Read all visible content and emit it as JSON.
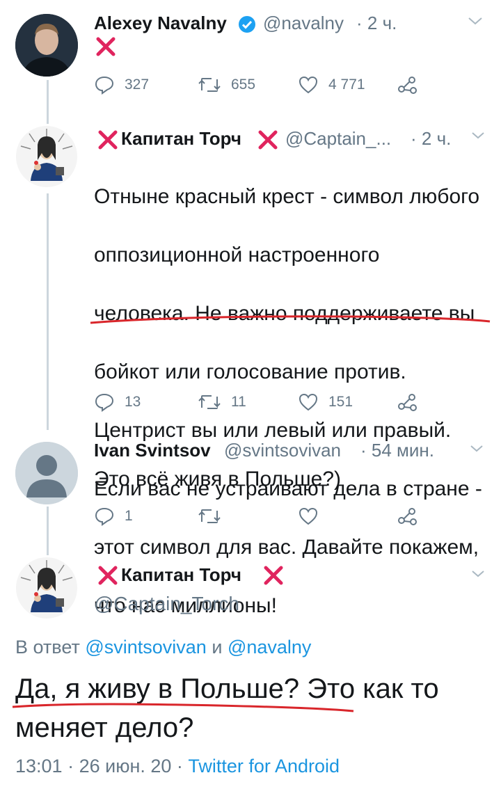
{
  "colors": {
    "accent": "#1b95e0",
    "muted": "#657786",
    "text": "#14171a",
    "red_cross": "#e0245e",
    "verified": "#1da1f2",
    "underline": "#d9262b"
  },
  "tweet1": {
    "name": "Alexey Navalny",
    "handle": "@navalny",
    "time": "· 2 ч.",
    "body_icon": "red-cross-icon",
    "replies": "327",
    "retweets": "655",
    "likes": "4 771"
  },
  "tweet2": {
    "name": "Капитан Торч",
    "handle": "@Captain_...",
    "time": "· 2 ч.",
    "lines": [
      "Отныне красный крест - символ любого",
      "оппозиционной настроенного",
      "человека. Не важно поддерживаете вы",
      "бойкот или голосование против.",
      "Центрист вы или левый или правый.",
      "Если вас не устраивают дела в стране -",
      "этот символ для вас. Давайте покажем,",
      "что нас миллионы!"
    ],
    "replies": "13",
    "retweets": "11",
    "likes": "151"
  },
  "tweet3": {
    "name": "Ivan Svintsov",
    "handle": "@svintsovivan",
    "time": "· 54 мин.",
    "body": "Это всё живя в Польше?)",
    "replies": "1"
  },
  "main_tweet": {
    "name": "Капитан Торч",
    "handle": "@Captain_Torch",
    "reply_prefix": "В ответ",
    "reply_user1": "@svintsovivan",
    "reply_and": "и",
    "reply_user2": "@navalny",
    "body_line1": "Да, я живу в Польше? Это как то",
    "body_line2": "меняет дело?",
    "time": "13:01",
    "date": "· 26 июн. 20 ·",
    "client": "Twitter for Android"
  },
  "icons": [
    "reply-icon",
    "retweet-icon",
    "like-icon",
    "share-icon",
    "chevron-down-icon",
    "verified-badge-icon"
  ]
}
